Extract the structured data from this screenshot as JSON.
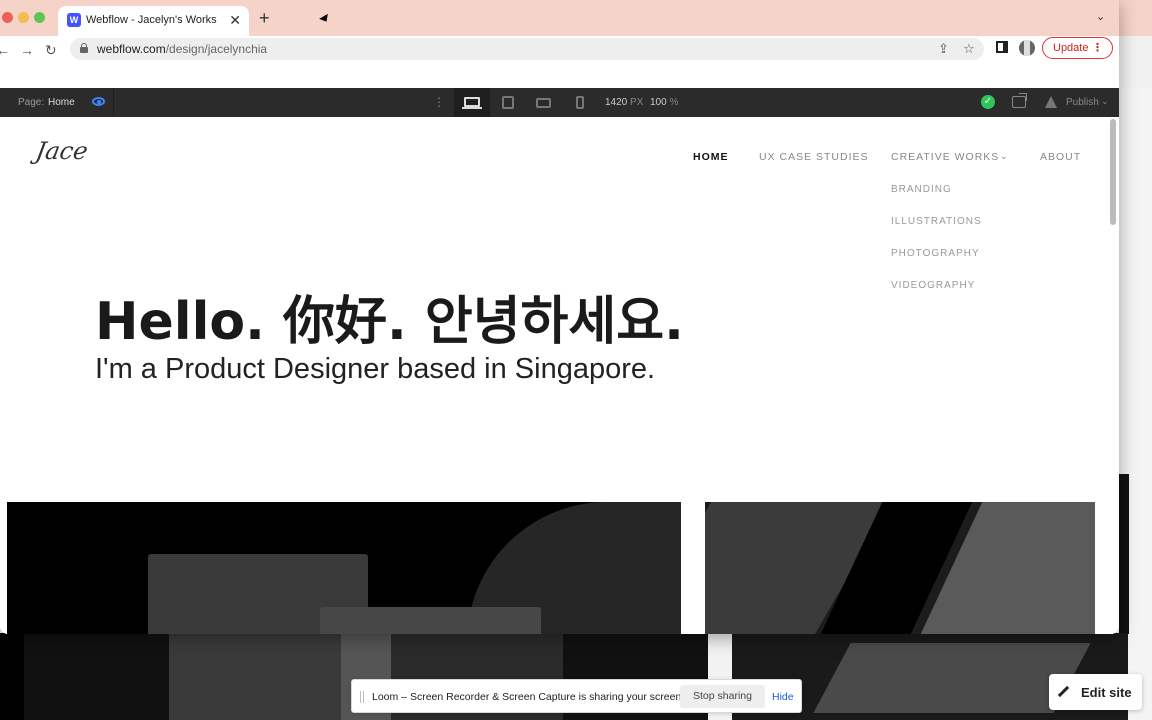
{
  "browser": {
    "tab_title": "Webflow - Jacelyn's Works",
    "tab_favicon": "W",
    "url_host": "webflow.com",
    "url_path": "/design/jacelynchia",
    "update_label": "Update"
  },
  "designer": {
    "page_label": "Page:",
    "page_name": "Home",
    "width_value": "1420",
    "width_unit": "PX",
    "zoom_value": "100",
    "zoom_unit": "%",
    "publish_label": "Publish"
  },
  "site": {
    "logo_text": "Jace",
    "nav": {
      "home": "HOME",
      "ux": "UX CASE STUDIES",
      "creative": "CREATIVE WORKS",
      "about": "ABOUT"
    },
    "dropdown": [
      "BRANDING",
      "ILLUSTRATIONS",
      "PHOTOGRAPHY",
      "VIDEOGRAPHY"
    ],
    "hero_title": "Hello. 你好. 안녕하세요.",
    "hero_subtitle": "I'm a Product Designer based in Singapore."
  },
  "loom": {
    "message": "Loom – Screen Recorder & Screen Capture is sharing your screen.",
    "stop_label": "Stop sharing",
    "hide_label": "Hide"
  },
  "edit_site_label": "Edit site"
}
